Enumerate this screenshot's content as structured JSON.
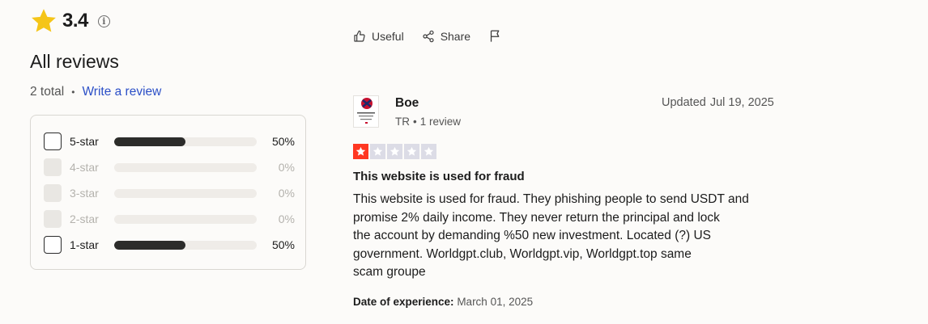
{
  "summary": {
    "rating": "3.4",
    "info_glyph": "i",
    "heading": "All reviews",
    "total": "2 total",
    "separator": "•",
    "write_review": "Write a review"
  },
  "distribution": [
    {
      "label": "5-star",
      "percent_text": "50%",
      "fraction": 0.5,
      "enabled": true
    },
    {
      "label": "4-star",
      "percent_text": "0%",
      "fraction": 0,
      "enabled": false
    },
    {
      "label": "3-star",
      "percent_text": "0%",
      "fraction": 0,
      "enabled": false
    },
    {
      "label": "2-star",
      "percent_text": "0%",
      "fraction": 0,
      "enabled": false
    },
    {
      "label": "1-star",
      "percent_text": "50%",
      "fraction": 0.5,
      "enabled": true
    }
  ],
  "previous_review": {
    "actions": {
      "useful": "Useful",
      "share": "Share"
    }
  },
  "review": {
    "reviewer_name": "Boe",
    "country": "TR",
    "meta_sep": "•",
    "review_count": "1 review",
    "updated_label": "Updated",
    "updated_date": "Jul 19, 2025",
    "rating": 1,
    "rating_color": "#ff3722",
    "title": "This website is used for fraud",
    "body_lines": [
      "This website is used for fraud. They phishing people to send USDT and",
      "promise 2% daily income. They never return the principal and lock",
      "the account by demanding %50 new investment. Located (?) US",
      "government. Worldgpt.club, Worldgpt.vip, Worldgpt.top same",
      "scam groupe"
    ],
    "doe_label": "Date of experience:",
    "doe_value": "March 01, 2025"
  },
  "colors": {
    "accent_link": "#2b4fc7",
    "star_gold": "#f5c518",
    "bar_fill": "#2c2c2a",
    "bar_track": "#efece8"
  }
}
